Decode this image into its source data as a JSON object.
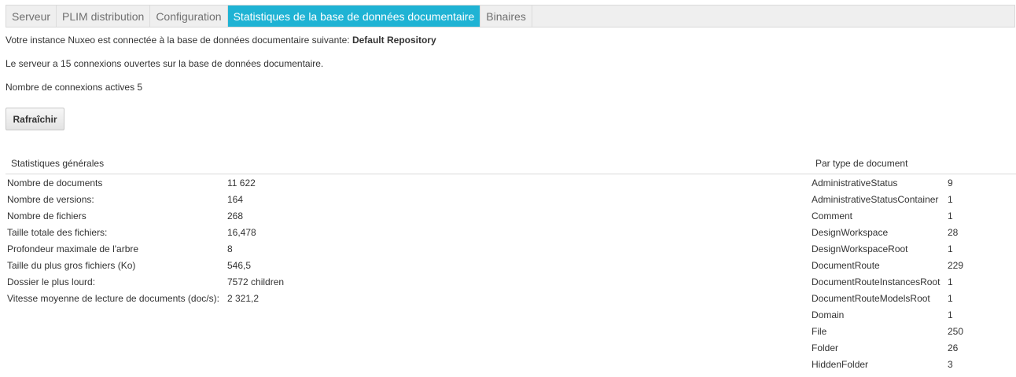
{
  "tabs": [
    {
      "label": "Serveur",
      "active": false
    },
    {
      "label": "PLIM distribution",
      "active": false
    },
    {
      "label": "Configuration",
      "active": false
    },
    {
      "label": "Statistiques de la base de données documentaire",
      "active": true
    },
    {
      "label": "Binaires",
      "active": false
    }
  ],
  "info": {
    "connected_prefix": "Votre instance Nuxeo est connectée à la base de données documentaire suivante: ",
    "repository_name": "Default Repository",
    "open_connections": "Le serveur a 15 connexions ouvertes sur la base de données documentaire.",
    "active_connections": "Nombre de connexions actives 5"
  },
  "refresh_button": "Rafraîchir",
  "general_stats": {
    "title": "Statistiques générales",
    "rows": [
      {
        "label": "Nombre de documents",
        "value": "11 622"
      },
      {
        "label": "Nombre de versions:",
        "value": "164"
      },
      {
        "label": "Nombre de fichiers",
        "value": "268"
      },
      {
        "label": "Taille totale des fichiers:",
        "value": "16,478"
      },
      {
        "label": "Profondeur maximale de l'arbre",
        "value": "8"
      },
      {
        "label": "Taille du plus gros fichiers (Ko)",
        "value": "546,5"
      },
      {
        "label": "Dossier le plus lourd:",
        "value": "7572 children"
      },
      {
        "label": "Vitesse moyenne de lecture de documents (doc/s):",
        "value": "2 321,2"
      }
    ]
  },
  "by_type": {
    "title": "Par type de document",
    "rows": [
      {
        "label": "AdministrativeStatus",
        "value": "9"
      },
      {
        "label": "AdministrativeStatusContainer",
        "value": "1"
      },
      {
        "label": "Comment",
        "value": "1"
      },
      {
        "label": "DesignWorkspace",
        "value": "28"
      },
      {
        "label": "DesignWorkspaceRoot",
        "value": "1"
      },
      {
        "label": "DocumentRoute",
        "value": "229"
      },
      {
        "label": "DocumentRouteInstancesRoot",
        "value": "1"
      },
      {
        "label": "DocumentRouteModelsRoot",
        "value": "1"
      },
      {
        "label": "Domain",
        "value": "1"
      },
      {
        "label": "File",
        "value": "250"
      },
      {
        "label": "Folder",
        "value": "26"
      },
      {
        "label": "HiddenFolder",
        "value": "3"
      }
    ]
  },
  "colors": {
    "active_tab": "#1fb3d4",
    "tab_bar": "#efefef"
  }
}
